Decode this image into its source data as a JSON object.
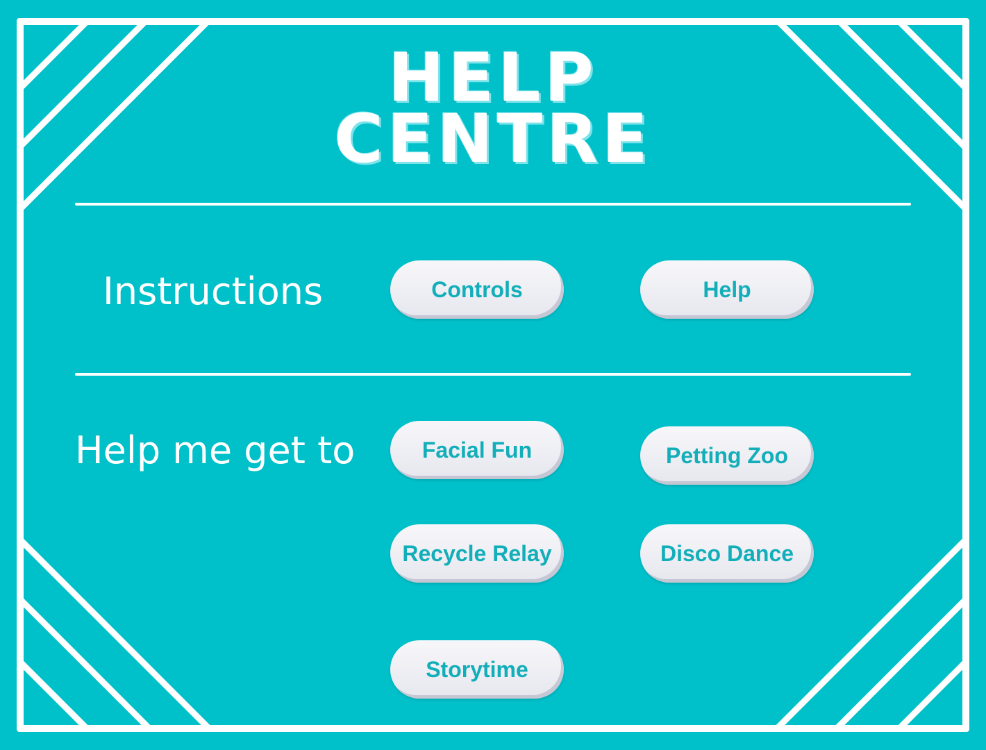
{
  "title": {
    "line1": "HELP",
    "line2": "CENTRE"
  },
  "instructions": {
    "label": "Instructions",
    "buttons": {
      "controls": "Controls",
      "help": "Help"
    }
  },
  "navigation": {
    "label": "Help me get to",
    "buttons": {
      "facial_fun": "Facial Fun",
      "petting_zoo": "Petting Zoo",
      "recycle_relay": "Recycle Relay",
      "disco_dance": "Disco Dance",
      "storytime": "Storytime"
    }
  },
  "colors": {
    "background": "#00c0ca",
    "foreground": "#ffffff",
    "button_fill": "#eef0f4",
    "button_text": "#12aeb9"
  }
}
